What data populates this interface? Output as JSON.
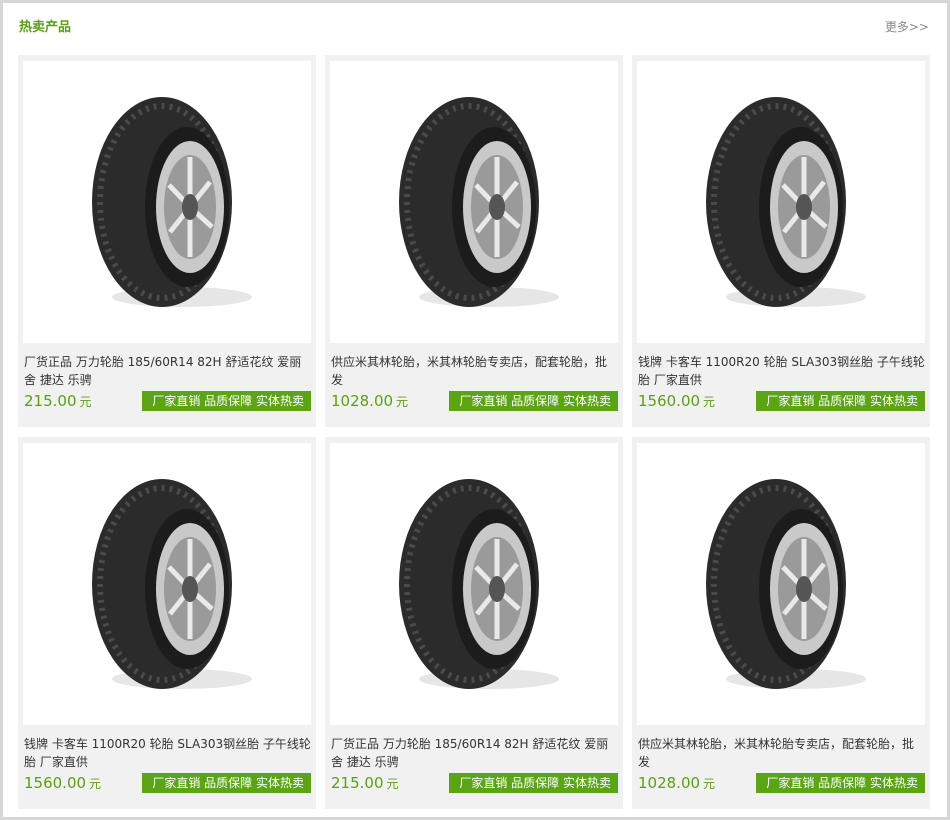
{
  "header": {
    "title": "热卖产品",
    "more_label": "更多>>"
  },
  "colors": {
    "accent": "#5c9e17",
    "tag_bg": "#5ba415",
    "card_bg": "#f1f1f1"
  },
  "products": [
    {
      "name": "厂货正品 万力轮胎 185/60R14 82H 舒适花纹 爱丽舍 捷达 乐骋",
      "price": "215.00",
      "unit": "元",
      "tags": "厂家直销 品质保障 实体热卖",
      "image": "tire-wheel-icon"
    },
    {
      "name": "供应米其林轮胎，米其林轮胎专卖店，配套轮胎，批发",
      "price": "1028.00",
      "unit": "元",
      "tags": "厂家直销 品质保障 实体热卖",
      "image": "tire-wheel-icon"
    },
    {
      "name": "钱牌 卡客车 1100R20 轮胎 SLA303钢丝胎 子午线轮胎 厂家直供",
      "price": "1560.00",
      "unit": "元",
      "tags": "厂家直销 品质保障 实体热卖",
      "image": "tire-wheel-icon"
    },
    {
      "name": "钱牌 卡客车 1100R20 轮胎 SLA303钢丝胎 子午线轮胎 厂家直供",
      "price": "1560.00",
      "unit": "元",
      "tags": "厂家直销 品质保障 实体热卖",
      "image": "tire-wheel-icon"
    },
    {
      "name": "厂货正品 万力轮胎 185/60R14 82H 舒适花纹 爱丽舍 捷达 乐骋",
      "price": "215.00",
      "unit": "元",
      "tags": "厂家直销 品质保障 实体热卖",
      "image": "tire-wheel-icon"
    },
    {
      "name": "供应米其林轮胎，米其林轮胎专卖店，配套轮胎，批发",
      "price": "1028.00",
      "unit": "元",
      "tags": "厂家直销 品质保障 实体热卖",
      "image": "tire-wheel-icon"
    }
  ]
}
